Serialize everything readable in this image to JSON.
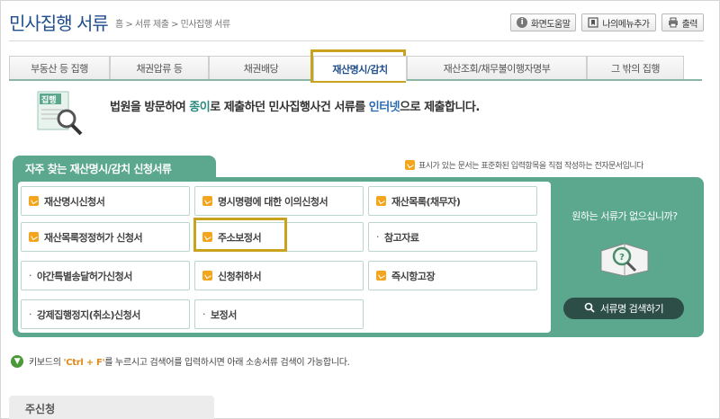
{
  "header": {
    "title": "민사집행 서류",
    "breadcrumb": "홈 > 서류 제출 > 민사집행 서류",
    "buttons": {
      "help": "화면도움말",
      "mymenu": "나의메뉴추가",
      "print": "출력"
    }
  },
  "tabs": [
    {
      "label": "부동산 등 집행"
    },
    {
      "label": "채권압류 등"
    },
    {
      "label": "채권배당"
    },
    {
      "label": "재산명시/감치"
    },
    {
      "label": "재산조회/채무불이행자명부"
    },
    {
      "label": "그 밖의 집행"
    }
  ],
  "active_tab": 3,
  "intro": {
    "icon_label": "집행",
    "part1": "법원을 방문하여 ",
    "paper": "종이",
    "part2": "로 제출하던 민사집행사건 서류를 ",
    "internet": "인터넷",
    "part3": "으로 제출합니다."
  },
  "panel": {
    "title": "자주 찾는 재산명시/감치 신청서류",
    "note": "표시가 있는 문서는 표준화된 입력항목을 직접 작성하는 전자문서입니다",
    "items": [
      {
        "label": "재산명시신청서"
      },
      {
        "label": "명시명령에 대한 이의신청서"
      },
      {
        "label": "재산목록(채무자)"
      },
      {
        "label": "재산목록정정허가 신청서"
      },
      {
        "label": "주소보정서"
      },
      {
        "label": "참고자료"
      },
      {
        "label": "야간특별송달허가신청서"
      },
      {
        "label": "신청취하서"
      },
      {
        "label": "즉시항고장"
      },
      {
        "label": "강제집행정지(취소)신청서"
      },
      {
        "label": "보정서"
      }
    ],
    "side_question": "원하는 서류가 없으십니까?",
    "search_button": "서류명 검색하기"
  },
  "hint": {
    "prefix": "키보드의 ",
    "key": "'Ctrl + F'",
    "suffix": "를 누르시고 검색어를 입력하시면 아래 소송서류 검색이 가능합니다."
  },
  "bottom_label": "주신청"
}
